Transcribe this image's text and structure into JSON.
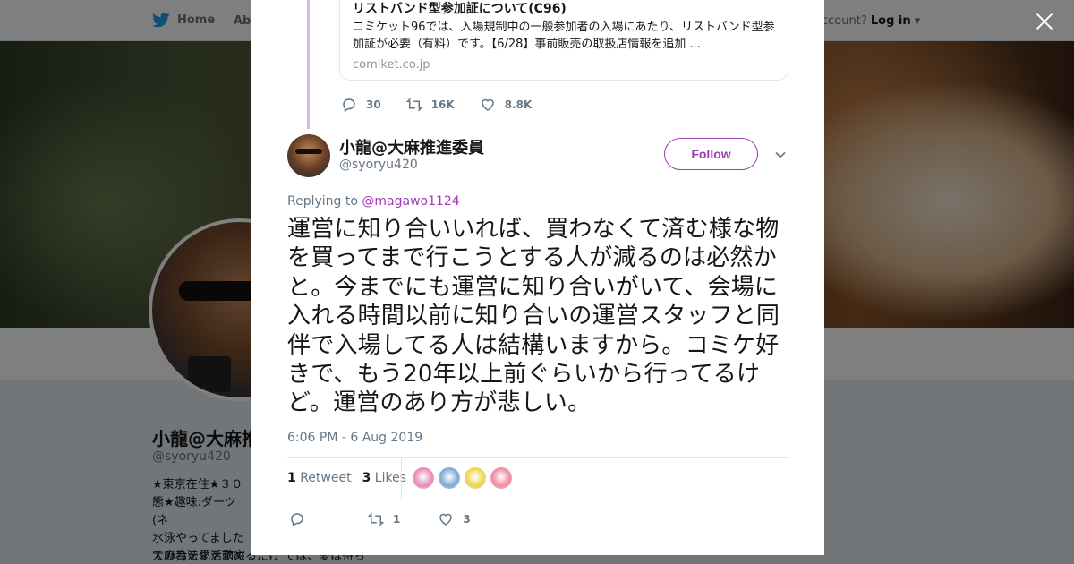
{
  "topnav": {
    "home_label": "Home",
    "about_label": "Abo",
    "account_prefix": "ccount?",
    "login_label": "Log in"
  },
  "profile": {
    "name": "小龍@大麻推",
    "handle": "@syoryu420",
    "bio": "★東京在住★３０\n態★趣味:ダーツ(ネ\n水泳やってました\n大麻合法化活動家",
    "bio_tail": "ての為を愛を求めるだけ では、愛は待ち"
  },
  "card": {
    "title": "リストバンド型参加証について(C96)",
    "description": "コミケット96では、入場規制中の一般参加者の入場にあたり、リストバンド型参加証が必要（有料）です。【6/28】事前販売の取扱店情報を追加 ...",
    "domain": "comiket.co.jp"
  },
  "prev_actions": {
    "replies": "30",
    "retweets": "16K",
    "likes": "8.8K"
  },
  "tweet": {
    "name": "小龍@大麻推進委員",
    "handle": "@syoryu420",
    "follow_label": "Follow",
    "replying_prefix": "Replying to",
    "replying_to": "@magawo1124",
    "text": "運営に知り合いいれば、買わなくて済む様な物を買ってまで行こうとする人が減るのは必然かと。今までにも運営に知り合いがいて、会場に入れる時間以前に知り合いの運営スタッフと同伴で入場してる人は結構いますから。コミケ好きで、もう20年以上前ぐらいから行ってるけど。運営のあり方が悲しい。",
    "timestamp": "6:06 PM - 6 Aug 2019",
    "retweet_count": "1",
    "retweet_label": "Retweet",
    "like_count": "3",
    "like_label": "Likes",
    "liker_colors": [
      "#e98bb8",
      "#7fa9d6",
      "#f0d64a",
      "#f28aa3"
    ],
    "actions": {
      "retweets": "1",
      "likes": "3"
    }
  },
  "colors": {
    "accent": "#a13ab8",
    "thread_line": "#d6b7e6",
    "twitter_blue": "#1da1f2"
  }
}
